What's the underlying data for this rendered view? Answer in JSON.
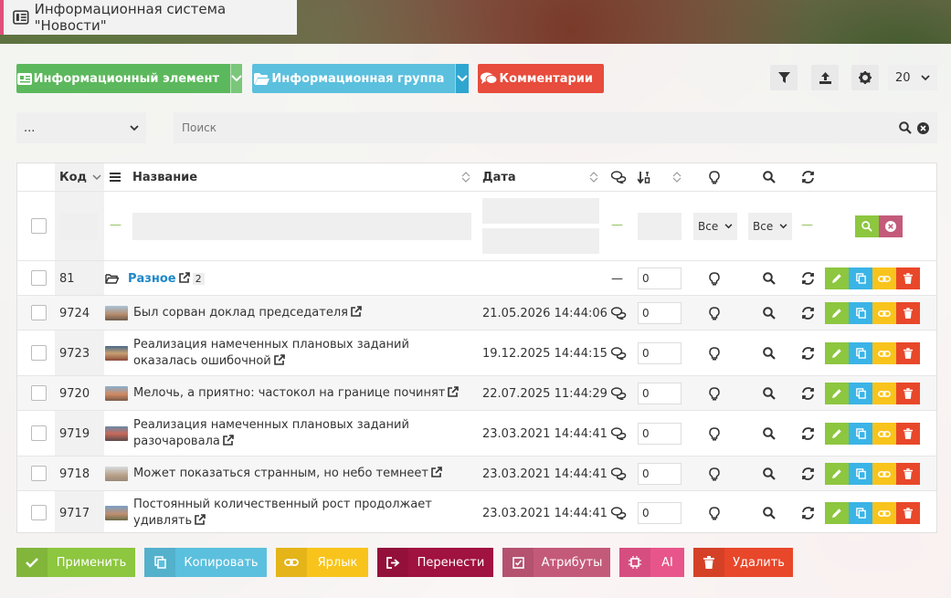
{
  "window": {
    "title": "Информационная система \"Новости\""
  },
  "toolbar": {
    "add_item_label": "Информационный элемент",
    "add_group_label": "Информационная группа",
    "comments_label": "Комментарии",
    "page_size": "20"
  },
  "filters": {
    "group_select": "...",
    "search_placeholder": "Поиск"
  },
  "table": {
    "headers": {
      "code": "Код",
      "name": "Название",
      "date": "Дата"
    },
    "filter_row": {
      "active_select": "Все",
      "indexed_select": "Все"
    },
    "rows": [
      {
        "code": "81",
        "name": "Разное",
        "count": "2",
        "date": "",
        "sorting": "0",
        "is_group": true
      },
      {
        "code": "9724",
        "name": "Был сорван доклад председателя",
        "date": "21.05.2026 14:44:06",
        "sorting": "0"
      },
      {
        "code": "9723",
        "name": "Реализация намеченных плановых заданий оказалась ошибочной",
        "date": "19.12.2025 14:44:15",
        "sorting": "0"
      },
      {
        "code": "9720",
        "name": "Мелочь, а приятно: частокол на границе починят",
        "date": "22.07.2025 11:44:29",
        "sorting": "0"
      },
      {
        "code": "9719",
        "name": "Реализация намеченных плановых заданий разочаровала",
        "date": "23.03.2021 14:44:41",
        "sorting": "0"
      },
      {
        "code": "9718",
        "name": "Может показаться странным, но небо темнеет",
        "date": "23.03.2021 14:44:41",
        "sorting": "0"
      },
      {
        "code": "9717",
        "name": "Постоянный количественный рост продолжает удивлять",
        "date": "23.03.2021 14:44:41",
        "sorting": "0"
      }
    ]
  },
  "footer": {
    "apply": "Применить",
    "copy": "Копировать",
    "shortcut": "Ярлык",
    "move": "Перенести",
    "attributes": "Атрибуты",
    "ai": "AI",
    "delete": "Удалить"
  },
  "colors": {
    "green": "#5cb85c",
    "blue": "#5bc0de",
    "red": "#e74c3c",
    "link": "#1e88c8",
    "maroon": "#a0123f",
    "rose": "#c45a7a",
    "pink": "#e8558a"
  }
}
